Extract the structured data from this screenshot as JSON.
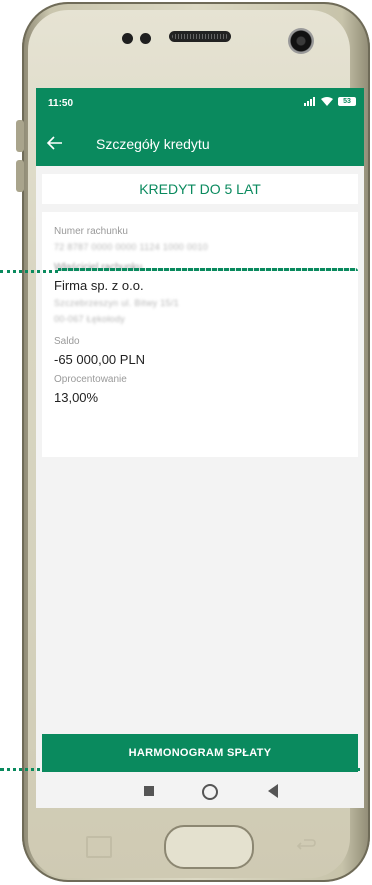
{
  "status_bar": {
    "time": "11:50",
    "icons": [
      "signal-icon",
      "wifi-icon",
      "battery-icon"
    ],
    "battery_level": "53"
  },
  "app_bar": {
    "title": "Szczegóły kredytu"
  },
  "card_title": "KREDYT DO 5 LAT",
  "details": {
    "account_number_label": "Numer rachunku",
    "account_number": "72 8787 0000 0000 1124 1000 0010",
    "owner_label": "Właściciel rachunku",
    "owner_name": "Firma sp. z o.o.",
    "owner_street": "Szczebrzeszyn ul. Bitwy 15/1",
    "owner_city": "00-067 Łękołody",
    "balance_label": "Saldo",
    "balance_value": "-65 000,00 PLN",
    "interest_label": "Oprocentowanie",
    "interest_value": "13,00%"
  },
  "button": {
    "label": "HARMONOGRAM SPŁATY"
  },
  "colors": {
    "accent": "#0a8a5e",
    "background": "#f3f3f3",
    "card": "#ffffff"
  }
}
